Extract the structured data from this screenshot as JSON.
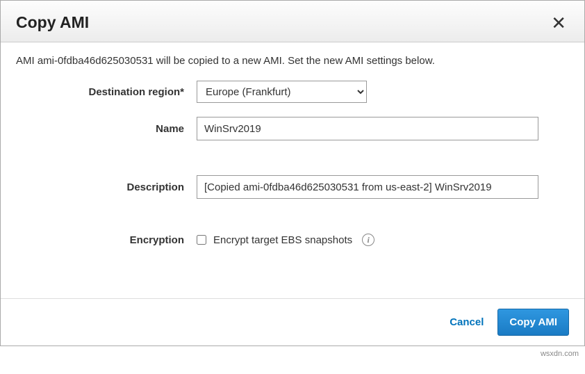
{
  "dialog": {
    "title": "Copy AMI",
    "intro": "AMI ami-0fdba46d625030531 will be copied to a new AMI. Set the new AMI settings below."
  },
  "form": {
    "region": {
      "label": "Destination region*",
      "value": "Europe (Frankfurt)"
    },
    "name": {
      "label": "Name",
      "value": "WinSrv2019"
    },
    "description": {
      "label": "Description",
      "value": "[Copied ami-0fdba46d625030531 from us-east-2] WinSrv2019"
    },
    "encryption": {
      "label": "Encryption",
      "checkbox_label": "Encrypt target EBS snapshots"
    }
  },
  "footer": {
    "cancel": "Cancel",
    "submit": "Copy AMI"
  },
  "watermark": "wsxdn.com"
}
